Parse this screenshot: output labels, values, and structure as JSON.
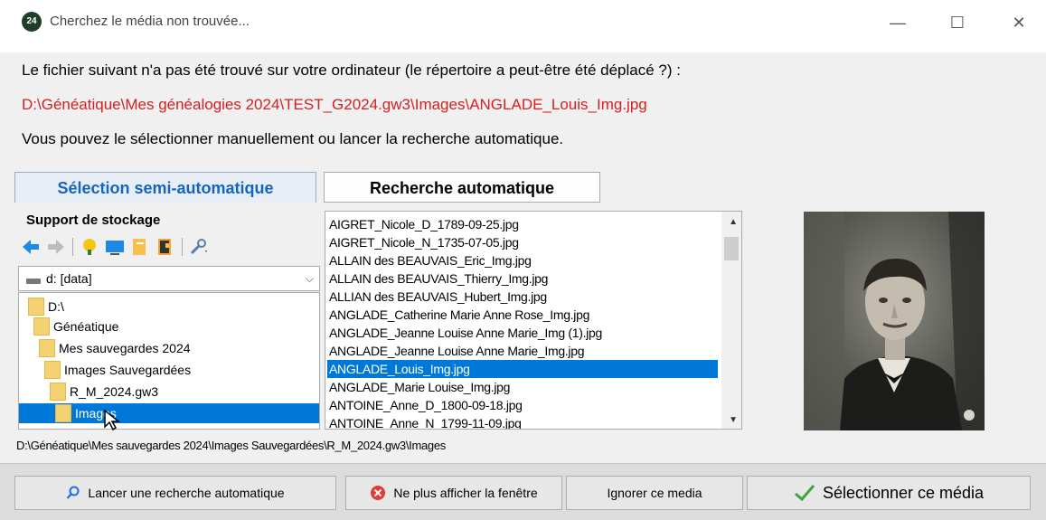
{
  "window": {
    "title": "Cherchez le média non trouvée...",
    "app_icon_text": "24",
    "minimize_glyph": "—",
    "maximize_glyph": "☐",
    "close_glyph": "✕"
  },
  "message": {
    "line1": "Le fichier suivant n'a pas été trouvé sur votre ordinateur (le répertoire a peut-être été déplacé ?) :",
    "missing_path": "D:\\Généatique\\Mes généalogies 2024\\TEST_G2024.gw3\\Images\\ANGLADE_Louis_Img.jpg",
    "line3": "Vous pouvez le sélectionner manuellement ou lancer la recherche automatique.",
    "path_color": "#d42020"
  },
  "tabs": [
    {
      "label": "Sélection semi-automatique",
      "active": true
    },
    {
      "label": "Recherche automatique",
      "active": false
    }
  ],
  "storage": {
    "label": "Support de stockage",
    "drive": "d: [data]",
    "toolbar_icons": [
      "back-arrow-icon",
      "forward-arrow-icon",
      "tree-icon",
      "monitor-icon",
      "document-icon",
      "book-icon",
      "tools-icon"
    ],
    "folders": [
      {
        "name": "D:\\",
        "selected": false
      },
      {
        "name": "Généatique",
        "selected": false
      },
      {
        "name": "Mes sauvegardes 2024",
        "selected": false
      },
      {
        "name": "Images Sauvegardées",
        "selected": false
      },
      {
        "name": "R_M_2024.gw3",
        "selected": false
      },
      {
        "name": "Images",
        "selected": true
      }
    ]
  },
  "files": [
    {
      "name": "AIGRET_Nicole_D_1789-09-25.jpg",
      "selected": false
    },
    {
      "name": "AIGRET_Nicole_N_1735-07-05.jpg",
      "selected": false
    },
    {
      "name": "ALLAIN des BEAUVAIS_Eric_Img.jpg",
      "selected": false
    },
    {
      "name": "ALLAIN des BEAUVAIS_Thierry_Img.jpg",
      "selected": false
    },
    {
      "name": "ALLIAN des BEAUVAIS_Hubert_Img.jpg",
      "selected": false
    },
    {
      "name": "ANGLADE_Catherine Marie Anne Rose_Img.jpg",
      "selected": false
    },
    {
      "name": "ANGLADE_Jeanne Louise Anne Marie_Img (1).jpg",
      "selected": false
    },
    {
      "name": "ANGLADE_Jeanne Louise Anne Marie_Img.jpg",
      "selected": false
    },
    {
      "name": "ANGLADE_Louis_Img.jpg",
      "selected": true
    },
    {
      "name": "ANGLADE_Marie Louise_Img.jpg",
      "selected": false
    },
    {
      "name": "ANTOINE_Anne_D_1800-09-18.jpg",
      "selected": false
    },
    {
      "name": "ANTOINE_Anne_N_1799-11-09.jpg",
      "selected": false
    }
  ],
  "status_path": "D:\\Généatique\\Mes sauvegardes 2024\\Images Sauvegardées\\R_M_2024.gw3\\Images",
  "buttons": {
    "search": "Lancer une recherche automatique",
    "hide": "Ne plus afficher la fenêtre",
    "ignore": "Ignorer ce media",
    "select": "Sélectionner ce média"
  },
  "colors": {
    "accent": "#1565c0",
    "selection": "#0078d7"
  }
}
